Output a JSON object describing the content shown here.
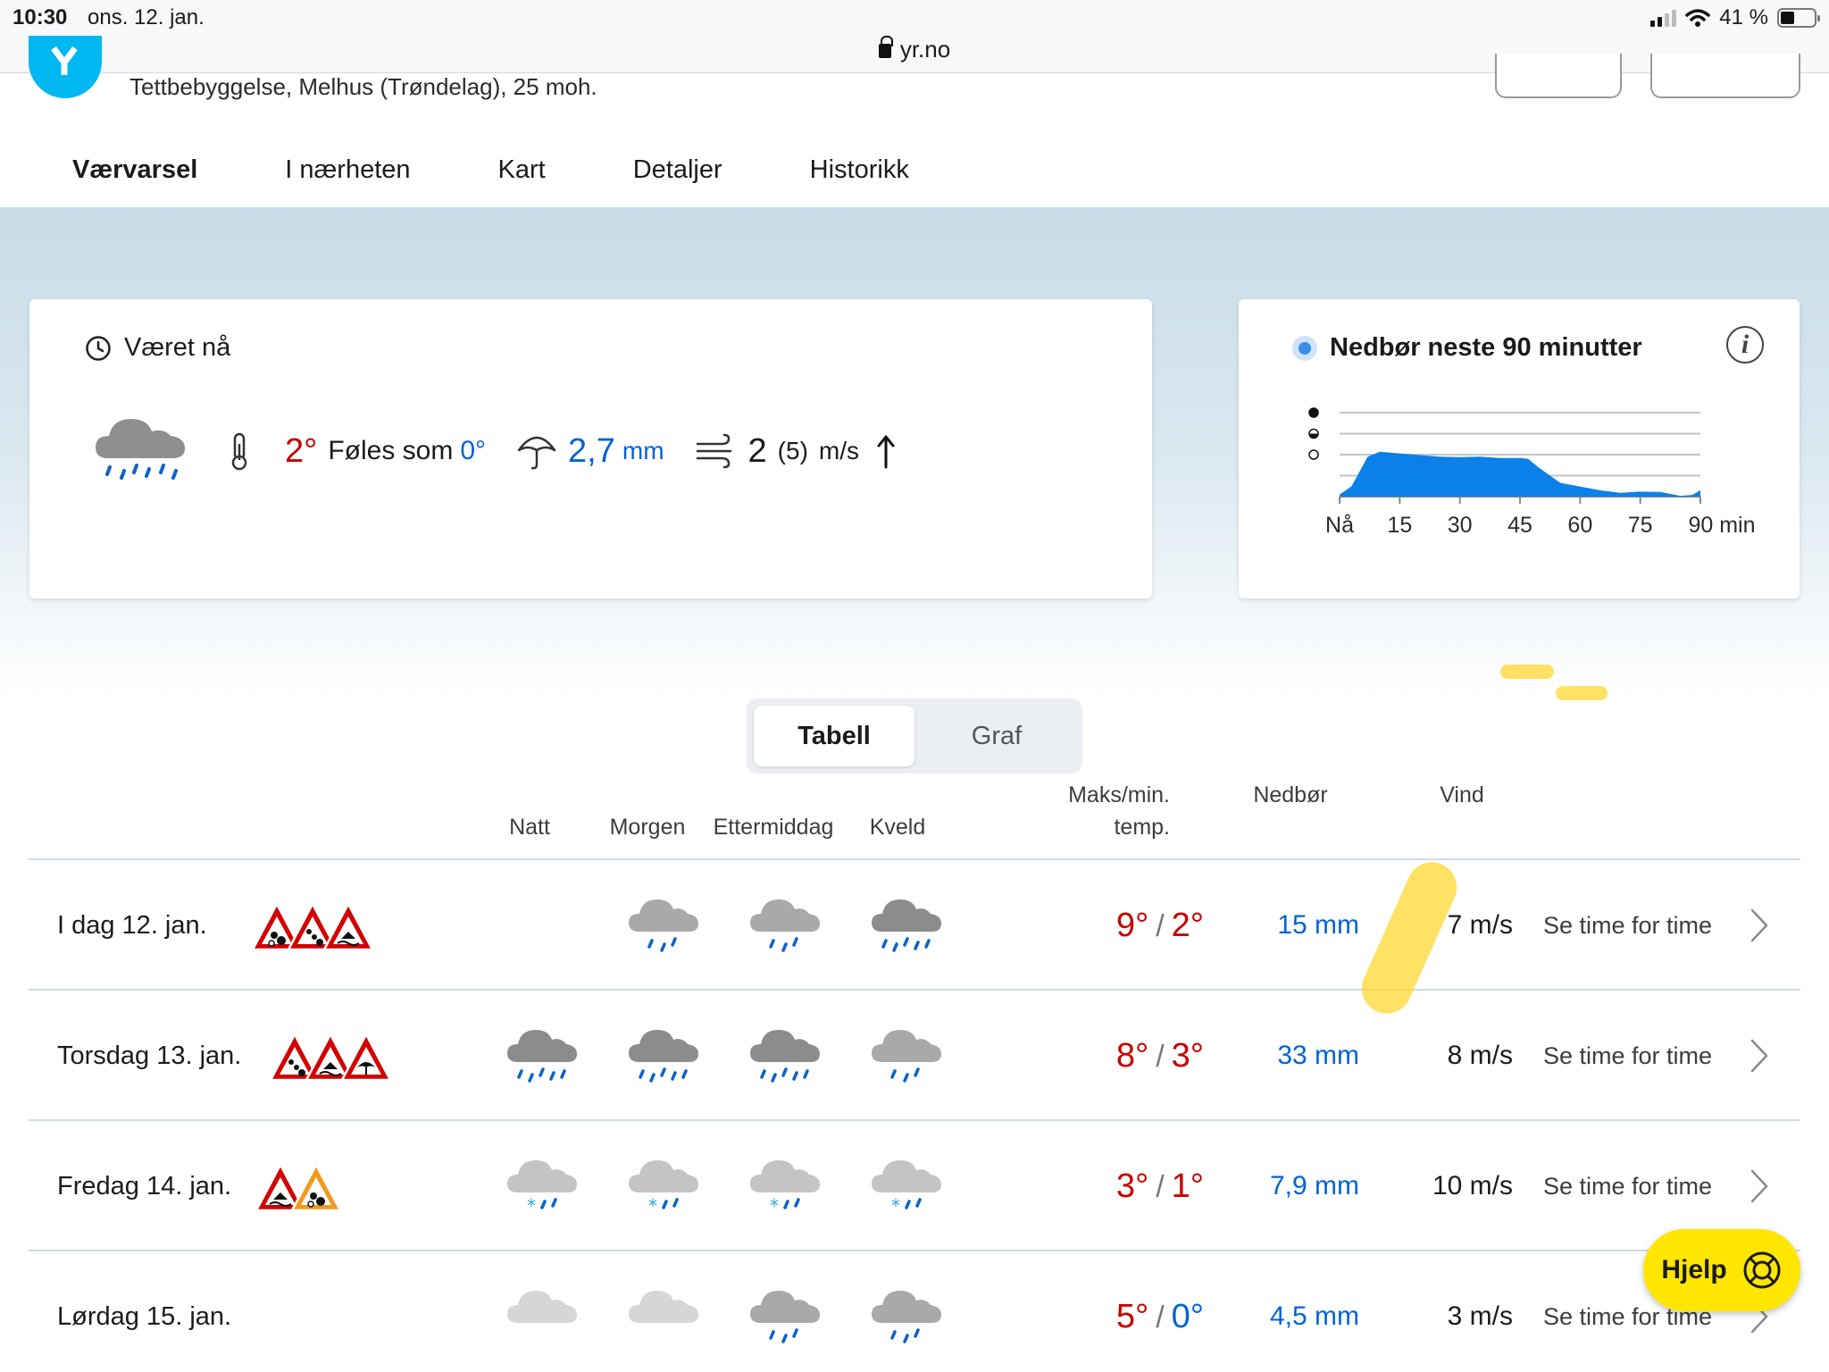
{
  "status_bar": {
    "time": "10:30",
    "date": "ons. 12. jan.",
    "url": "yr.no",
    "battery": "41 %"
  },
  "header": {
    "location": "Tettbebyggelse, Melhus (Trøndelag), 25 moh."
  },
  "tabs": [
    {
      "label": "Værvarsel",
      "active": true
    },
    {
      "label": "I nærheten",
      "active": false
    },
    {
      "label": "Kart",
      "active": false
    },
    {
      "label": "Detaljer",
      "active": false
    },
    {
      "label": "Historikk",
      "active": false
    }
  ],
  "now": {
    "title": "Været nå",
    "icon": "heavy-rain-cloud-icon",
    "temperature": "2°",
    "feels_like_label": "Føles som",
    "feels_like_value": "0°",
    "precipitation_value": "2,7",
    "precipitation_unit": "mm",
    "wind_value": "2",
    "wind_gust": "(5)",
    "wind_unit": "m/s"
  },
  "nowcast": {
    "title": "Nedbør neste 90 minutter",
    "x_ticks": [
      "Nå",
      "15",
      "30",
      "45",
      "60",
      "75",
      "90 min"
    ],
    "chart_data": {
      "type": "area",
      "title": "Nedbør neste 90 minutter",
      "x": [
        0,
        3,
        7,
        10,
        15,
        20,
        25,
        30,
        35,
        40,
        45,
        47,
        50,
        55,
        60,
        65,
        70,
        75,
        80,
        85,
        88,
        90
      ],
      "values": [
        0.05,
        0.25,
        0.95,
        1.07,
        1.03,
        0.99,
        0.95,
        0.94,
        0.95,
        0.92,
        0.92,
        0.9,
        0.67,
        0.33,
        0.24,
        0.15,
        0.09,
        0.12,
        0.11,
        0.02,
        0.04,
        0.15
      ],
      "xlim": [
        0,
        90
      ],
      "ylim": [
        0,
        2
      ],
      "y_levels": [
        "light",
        "moderate",
        "heavy"
      ],
      "grid": true,
      "color": "#0a80e8"
    }
  },
  "view_toggle": {
    "selected": "Tabell",
    "other": "Graf"
  },
  "table": {
    "headers": {
      "natt": "Natt",
      "morgen": "Morgen",
      "ettermiddag": "Ettermiddag",
      "kveld": "Kveld",
      "temp_line1": "Maks/min.",
      "temp_line2": "temp.",
      "precip": "Nedbør",
      "wind": "Vind"
    },
    "rows": [
      {
        "day": "I dag 12. jan.",
        "warnings": [
          {
            "icon": "landslide-warning-icon",
            "color": "#d20000"
          },
          {
            "icon": "avalanche-warning-icon",
            "color": "#d20000"
          },
          {
            "icon": "flood-warning-icon",
            "color": "#d20000"
          }
        ],
        "periods": [
          "none",
          "light-rain-icon",
          "light-rain-icon",
          "heavy-rain-icon"
        ],
        "max": "9°",
        "min": "2°",
        "min_cold": false,
        "precip": "15 mm",
        "wind": "7 m/s",
        "link": "Se time for time"
      },
      {
        "day": "Torsdag 13. jan.",
        "warnings": [
          {
            "icon": "avalanche-warning-icon",
            "color": "#d20000"
          },
          {
            "icon": "flood-warning-icon",
            "color": "#d20000"
          },
          {
            "icon": "rain-warning-icon",
            "color": "#d20000"
          }
        ],
        "periods": [
          "heavy-rain-icon",
          "heavy-rain-icon",
          "heavy-rain-icon",
          "light-rain-icon"
        ],
        "max": "8°",
        "min": "3°",
        "min_cold": false,
        "precip": "33 mm",
        "wind": "8 m/s",
        "link": "Se time for time"
      },
      {
        "day": "Fredag 14. jan.",
        "warnings": [
          {
            "icon": "flood-warning-icon",
            "color": "#d20000"
          },
          {
            "icon": "landslide-warning-icon",
            "color": "#f39a1e"
          }
        ],
        "periods": [
          "sleet-icon",
          "sleet-icon",
          "sleet-icon",
          "sleet-icon"
        ],
        "max": "3°",
        "min": "1°",
        "min_cold": false,
        "precip": "7,9 mm",
        "wind": "10 m/s",
        "link": "Se time for time"
      },
      {
        "day": "Lørdag 15. jan.",
        "warnings": [],
        "periods": [
          "cloud-icon",
          "cloud-icon",
          "light-rain-icon",
          "light-rain-icon"
        ],
        "max": "5°",
        "min": "0°",
        "min_cold": true,
        "precip": "4,5 mm",
        "wind": "3 m/s",
        "link": "Se time for time"
      }
    ]
  },
  "help": {
    "label": "Hjelp"
  }
}
